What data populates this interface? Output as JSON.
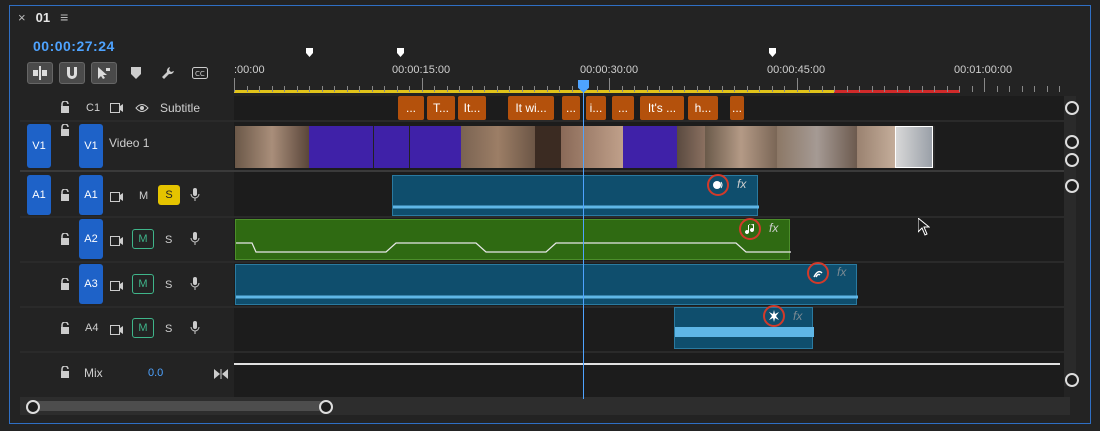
{
  "sequence": {
    "close_label": "×",
    "name": "01",
    "menu_label": "≡"
  },
  "timecode": "00:00:27:24",
  "ruler": {
    "labels": [
      ":00:00",
      "00:00:15:00",
      "00:00:30:00",
      "00:00:45:00",
      "00:01:00:00"
    ]
  },
  "tracks": {
    "c1": {
      "label": "C1",
      "name": "Subtitle"
    },
    "v1": {
      "source": "V1",
      "label": "V1",
      "name": "Video 1"
    },
    "a1": {
      "source": "A1",
      "label": "A1",
      "m": "M",
      "s": "S"
    },
    "a2": {
      "label": "A2",
      "m": "M",
      "s": "S"
    },
    "a3": {
      "source": "A3",
      "label": "A3",
      "m": "M",
      "s": "S"
    },
    "a4": {
      "label": "A4",
      "m": "M",
      "s": "S"
    },
    "mix": {
      "label": "Mix",
      "value": "0.0"
    }
  },
  "subtitles": [
    "T...",
    "It...",
    "It wi...",
    "...",
    "i...",
    "...",
    "It's ...",
    "h...",
    "..."
  ],
  "fx_label": "fx",
  "badges": {
    "a1": "dialogue-icon",
    "a2": "music-icon",
    "a3": "ambience-icon",
    "a4": "sfx-icon"
  },
  "colors": {
    "accent": "#4ea3ff",
    "subtitle": "#b4510c",
    "audio": "#0f4e6d",
    "music": "#2f6a12",
    "badge": "#d23a2a"
  }
}
